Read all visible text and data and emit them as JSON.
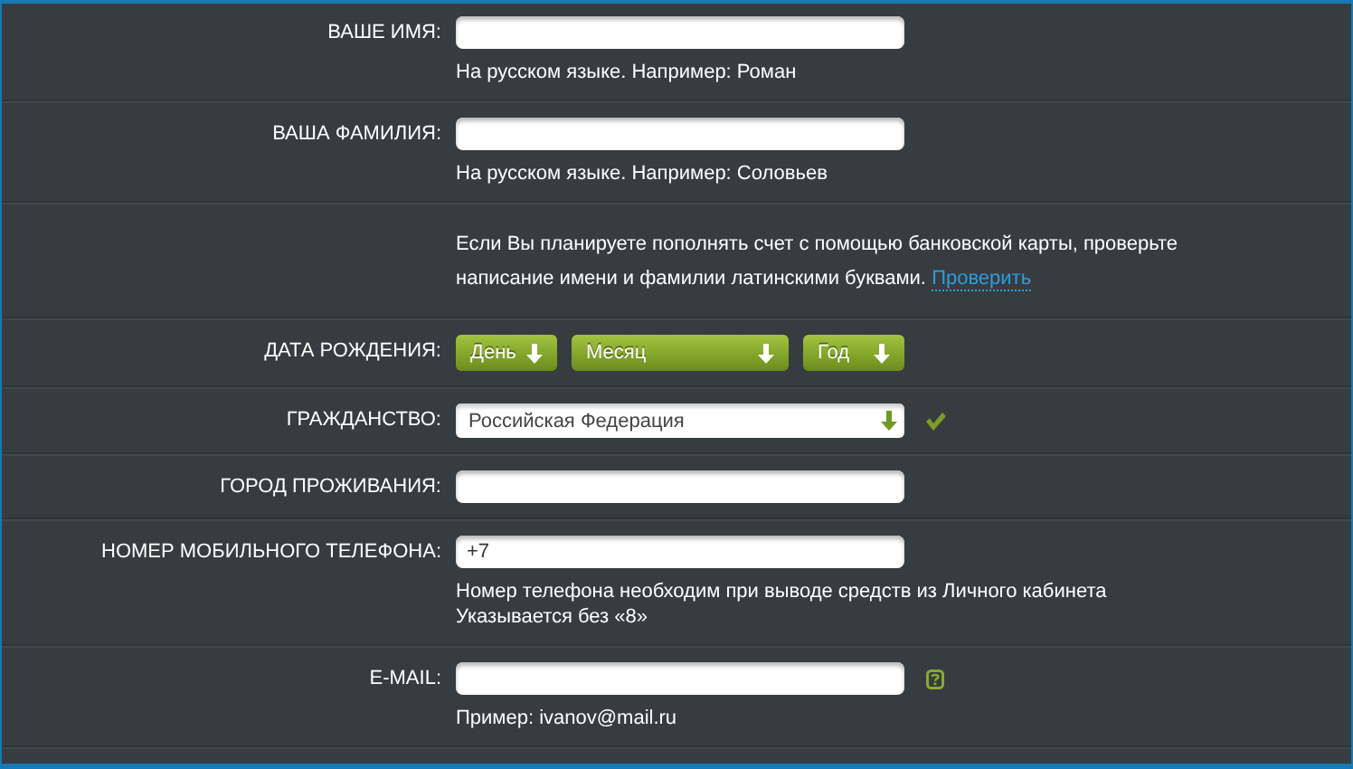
{
  "rows": [
    {
      "kind": "text",
      "label": "ВАШЕ ИМЯ:",
      "hints": [
        "На русском языке. Например: Роман"
      ]
    },
    {
      "kind": "text",
      "label": "ВАША ФАМИЛИЯ:",
      "hints": [
        "На русском языке. Например: Соловьев"
      ]
    },
    {
      "kind": "note",
      "text": "Если Вы планируете пополнять счет с помощью банковской карты, проверьте написание имени и фамилии латинскими буквами.",
      "link": "Проверить"
    },
    {
      "kind": "date",
      "label": "ДАТА РОЖДЕНИЯ:",
      "selects": [
        "День",
        "Месяц",
        "Год"
      ]
    },
    {
      "kind": "select",
      "label": "ГРАЖДАНСТВО:",
      "value": "Российская Федерация",
      "valid": true
    },
    {
      "kind": "text",
      "label": "ГОРОД ПРОЖИВАНИЯ:"
    },
    {
      "kind": "text",
      "label": "НОМЕР МОБИЛЬНОГО ТЕЛЕФОНА:",
      "value": "+7",
      "hints": [
        "Номер телефона необходим при выводе средств из Личного кабинета",
        "Указывается без «8»"
      ]
    },
    {
      "kind": "text",
      "label": "E-MAIL:",
      "help": true,
      "hints": [
        "Пример: ivanov@mail.ru"
      ]
    }
  ]
}
